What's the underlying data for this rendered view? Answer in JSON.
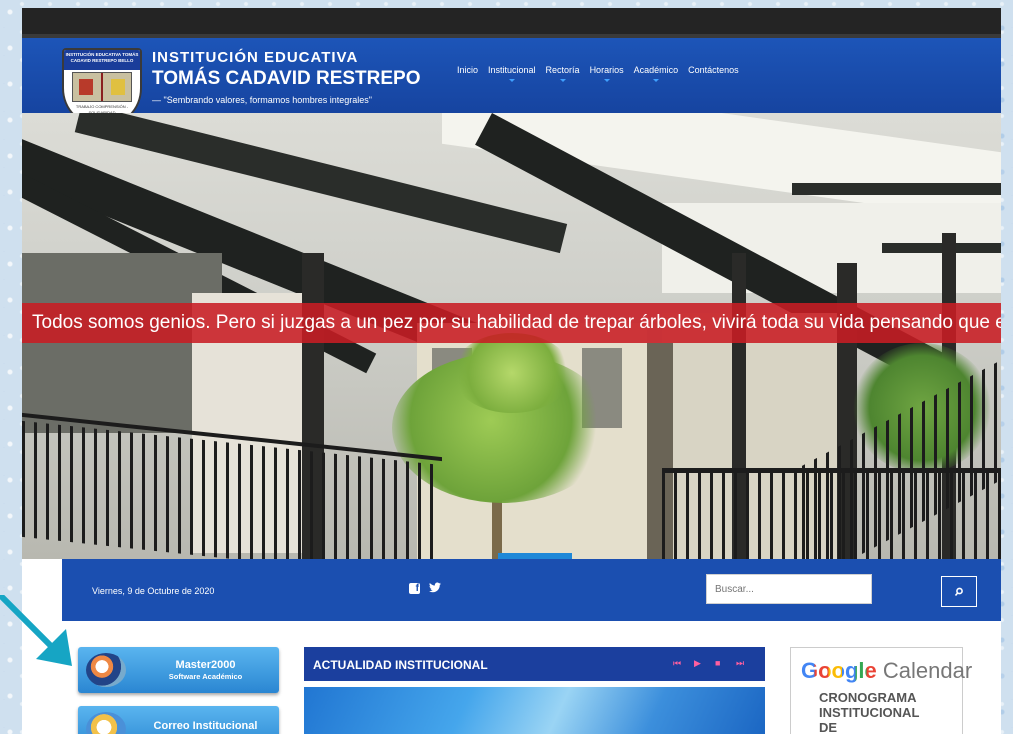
{
  "header": {
    "crest": {
      "top_text": "INSTITUCIÓN EDUCATIVA TOMÁS CADAVID RESTREPO BELLO",
      "bottom_text": "TRABAJO COMPRENSIÓN - SOLIDARIDAD"
    },
    "school_line1": "INSTITUCIÓN EDUCATIVA",
    "school_line2": "TOMÁS CADAVID RESTREPO",
    "motto": "— \"Sembrando valores, formamos hombres integrales\"",
    "nav": [
      {
        "label": "Inicio",
        "has_dropdown": false
      },
      {
        "label": "Institucional",
        "has_dropdown": true
      },
      {
        "label": "Rectoría",
        "has_dropdown": true
      },
      {
        "label": "Horarios",
        "has_dropdown": true
      },
      {
        "label": "Académico",
        "has_dropdown": true
      },
      {
        "label": "Contáctenos",
        "has_dropdown": false
      }
    ]
  },
  "hero": {
    "quote": "Todos somos genios. Pero si juzgas a un pez por su habilidad de trepar árboles, vivirá toda su vida pensando que es un inútil."
  },
  "infobar": {
    "date": "Viernes, 9 de Octubre de 2020",
    "social": [
      {
        "icon": "facebook-icon"
      },
      {
        "icon": "twitter-icon"
      }
    ],
    "search_placeholder": "Buscar...",
    "search_icon": "search-icon"
  },
  "sidebar": {
    "buttons": [
      {
        "title": "Master2000",
        "subtitle": "Software Académico",
        "icon": "master2000-logo-icon"
      },
      {
        "title": "Correo Institucional",
        "subtitle": "",
        "icon": "mail-logo-icon"
      }
    ]
  },
  "news": {
    "title": "ACTUALIDAD INSTITUCIONAL",
    "controls": [
      "first-icon",
      "play-icon",
      "stop-icon",
      "last-icon"
    ]
  },
  "calendar": {
    "brand_google": "Google",
    "brand_calendar": "Calendar",
    "subtitle": "CRONOGRAMA INSTITUCIONAL DE"
  },
  "colors": {
    "header_blue": "#1d55b8",
    "quote_red": "#c81c23",
    "infobar_blue": "#1b4fb0",
    "button_blue": "#3a9de3",
    "arrow_teal": "#16a5c4"
  }
}
